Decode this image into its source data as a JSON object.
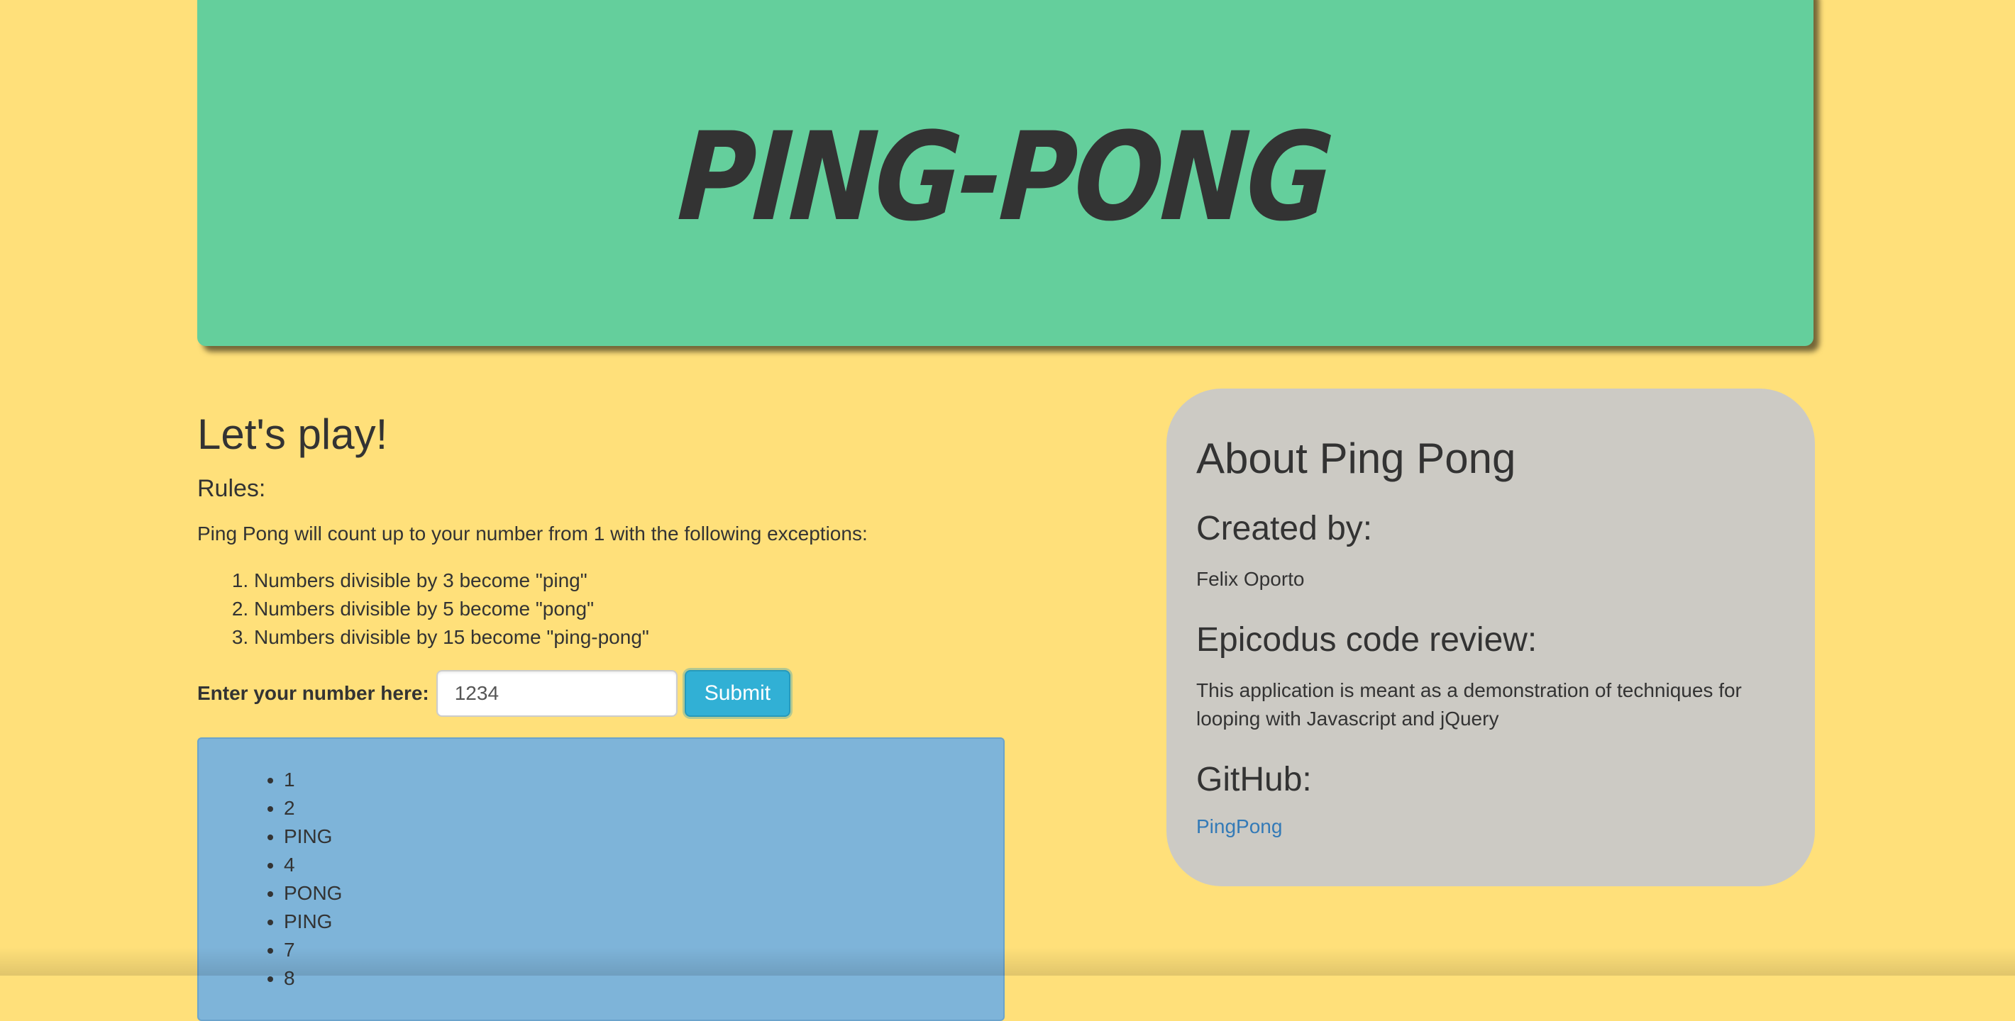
{
  "header": {
    "title": "PING-PONG"
  },
  "game": {
    "heading": "Let's play!",
    "rules_heading": "Rules:",
    "intro": "Ping Pong will count up to your number from 1 with the following exceptions:",
    "rules": [
      "Numbers divisible by 3 become \"ping\"",
      "Numbers divisible by 5 become \"pong\"",
      "Numbers divisible by 15 become \"ping-pong\""
    ],
    "input_label": "Enter your number here:",
    "input_value": "1234",
    "submit_label": "Submit"
  },
  "results": [
    "1",
    "2",
    "PING",
    "4",
    "PONG",
    "PING",
    "7",
    "8"
  ],
  "about": {
    "title": "About Ping Pong",
    "created_heading": "Created by:",
    "author": "Felix Oporto",
    "review_heading": "Epicodus code review:",
    "review_text": "This application is meant as a demonstration of techniques for looping with Javascript and jQuery",
    "github_heading": "GitHub:",
    "github_link": "PingPong"
  },
  "colors": {
    "page_background": "#ffe07a",
    "header_background": "#64cf9c",
    "about_background": "#cccac4",
    "results_background": "#7eb4d9",
    "submit_button": "#31b0d5",
    "link": "#337ab7"
  }
}
